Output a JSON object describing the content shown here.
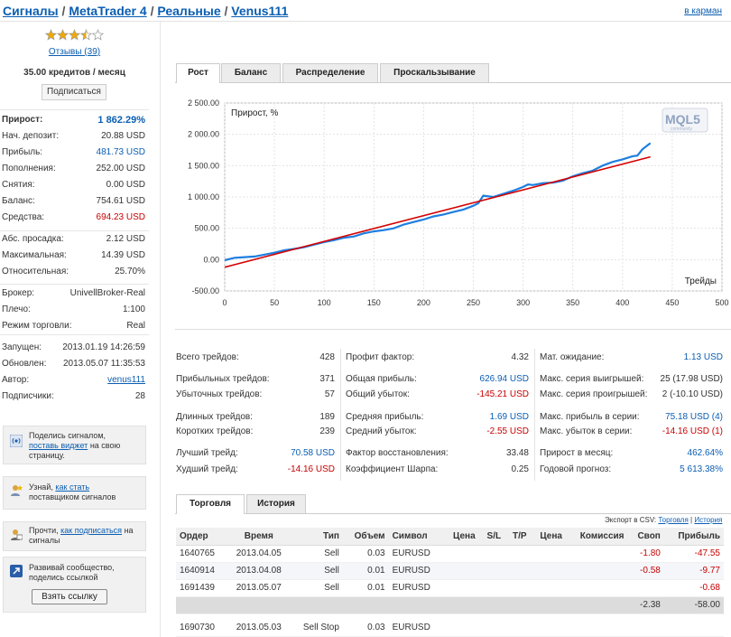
{
  "breadcrumb": {
    "items": [
      "Сигналы",
      "MetaTrader 4",
      "Реальные",
      "Venus111"
    ],
    "sep": "/"
  },
  "cart_link": "в карман",
  "sidebar": {
    "rating_stars": 3.5,
    "reviews": "Отзывы (39)",
    "price": "35.00 кредитов / месяц",
    "subscribe": "Подписаться",
    "growth": {
      "label": "Прирост:",
      "value": "1 862.29%"
    },
    "stats1": [
      {
        "label": "Нач. депозит:",
        "value": "20.88 USD"
      },
      {
        "label": "Прибыль:",
        "value": "481.73 USD"
      },
      {
        "label": "Пополнения:",
        "value": "252.00 USD"
      },
      {
        "label": "Снятия:",
        "value": "0.00 USD"
      },
      {
        "label": "Баланс:",
        "value": "754.61 USD"
      },
      {
        "label": "Средства:",
        "value": "694.23 USD"
      }
    ],
    "stats2": [
      {
        "label": "Абс. просадка:",
        "value": "2.12 USD"
      },
      {
        "label": "Максимальная:",
        "value": "14.39 USD"
      },
      {
        "label": "Относительная:",
        "value": "25.70%"
      }
    ],
    "stats3": [
      {
        "label": "Брокер:",
        "value": "UnivellBroker-Real"
      },
      {
        "label": "Плечо:",
        "value": "1:100"
      },
      {
        "label": "Режим торговли:",
        "value": "Real"
      }
    ],
    "stats4": [
      {
        "label": "Запущен:",
        "value": "2013.01.19 14:26:59"
      },
      {
        "label": "Обновлен:",
        "value": "2013.05.07 11:35:53"
      },
      {
        "label": "Автор:",
        "value": "venus111"
      },
      {
        "label": "Подписчики:",
        "value": "28"
      }
    ],
    "box1": {
      "pre": "Поделись сигналом,",
      "link": "поставь виджет",
      "post": "на свою страницу."
    },
    "box2": {
      "pre": "Узнай,",
      "link": "как стать",
      "post": "поставщиком сигналов"
    },
    "box3": {
      "pre": "Прочти,",
      "link": "как подписаться",
      "post": "на сигналы"
    },
    "box4": {
      "text": "Развивай сообщество, поделись ссылкой",
      "button": "Взять ссылку"
    }
  },
  "tabs": [
    "Рост",
    "Баланс",
    "Распределение",
    "Проскальзывание"
  ],
  "chart_data": {
    "type": "line",
    "ylabel": "Прирост, %",
    "xlabel": "Трейды",
    "watermark": "MQL5",
    "watermark_sub": "community",
    "xlim": [
      0,
      500
    ],
    "ylim": [
      -500,
      2500
    ],
    "x_ticks": [
      "0",
      "50",
      "100",
      "150",
      "200",
      "250",
      "300",
      "350",
      "400",
      "450",
      "500"
    ],
    "y_ticks": [
      "2 500.00",
      "2 000.00",
      "1 500.00",
      "1 000.00",
      "500.00",
      "0.00",
      "-500.00"
    ],
    "series": [
      {
        "color": "#1e7ee0",
        "x": [
          0,
          10,
          20,
          30,
          40,
          50,
          60,
          70,
          80,
          90,
          100,
          110,
          120,
          130,
          140,
          150,
          160,
          170,
          180,
          190,
          200,
          210,
          220,
          230,
          240,
          250,
          255,
          260,
          270,
          280,
          290,
          300,
          305,
          310,
          320,
          330,
          340,
          350,
          360,
          370,
          380,
          390,
          400,
          410,
          415,
          420,
          428
        ],
        "y": [
          -10,
          30,
          40,
          50,
          80,
          110,
          150,
          170,
          200,
          240,
          280,
          310,
          350,
          370,
          420,
          450,
          470,
          500,
          560,
          600,
          640,
          690,
          720,
          760,
          800,
          860,
          900,
          1020,
          1000,
          1050,
          1100,
          1160,
          1200,
          1190,
          1220,
          1230,
          1260,
          1330,
          1380,
          1420,
          1500,
          1560,
          1600,
          1650,
          1660,
          1760,
          1860
        ]
      },
      {
        "color": "#d40000",
        "x": [
          0,
          428
        ],
        "y": [
          -120,
          1640
        ]
      }
    ]
  },
  "stats_cols": [
    [
      {
        "label": "Всего трейдов:",
        "value": "428"
      },
      {
        "label": "Прибыльных трейдов:",
        "value": "371"
      },
      {
        "label": "Убыточных трейдов:",
        "value": "57"
      },
      {
        "label": "Длинных трейдов:",
        "value": "189"
      },
      {
        "label": "Коротких трейдов:",
        "value": "239"
      },
      {
        "label": "Лучший трейд:",
        "value": "70.58 USD"
      },
      {
        "label": "Худший трейд:",
        "value": "-14.16 USD"
      }
    ],
    [
      {
        "label": "Профит фактор:",
        "value": "4.32"
      },
      {
        "label": "Общая прибыль:",
        "value": "626.94 USD"
      },
      {
        "label": "Общий убыток:",
        "value": "-145.21 USD"
      },
      {
        "label": "Средняя прибыль:",
        "value": "1.69 USD"
      },
      {
        "label": "Средний убыток:",
        "value": "-2.55 USD"
      },
      {
        "label": "Фактор восстановления:",
        "value": "33.48"
      },
      {
        "label": "Коэффициент Шарпа:",
        "value": "0.25"
      }
    ],
    [
      {
        "label": "Мат. ожидание:",
        "value": "1.13 USD"
      },
      {
        "label": "Макс. серия выигрышей:",
        "value": "25 (17.98 USD)"
      },
      {
        "label": "Макс. серия проигрышей:",
        "value": "2 (-10.10 USD)"
      },
      {
        "label": "Макс. прибыль в серии:",
        "value": "75.18 USD (4)"
      },
      {
        "label": "Макс. убыток в серии:",
        "value": "-14.16 USD (1)"
      },
      {
        "label": "Прирост в месяц:",
        "value": "462.64%"
      },
      {
        "label": "Годовой прогноз:",
        "value": "5 613.38%"
      }
    ]
  ],
  "bottom_tabs": [
    "Торговля",
    "История"
  ],
  "csv": {
    "label": "Экспорт в CSV:",
    "trading": "Торговля",
    "sep": "|",
    "history": "История"
  },
  "table": {
    "headers": [
      "Ордер",
      "Время",
      "Тип",
      "Объем",
      "Символ",
      "Цена",
      "S/L",
      "T/P",
      "Цена",
      "Комиссия",
      "Своп",
      "Прибыль"
    ],
    "rows": [
      [
        "1640765",
        "2013.04.05",
        "Sell",
        "0.03",
        "EURUSD",
        "",
        "",
        "",
        "",
        "",
        "-1.80",
        "-47.55"
      ],
      [
        "1640914",
        "2013.04.08",
        "Sell",
        "0.01",
        "EURUSD",
        "",
        "",
        "",
        "",
        "",
        "-0.58",
        "-9.77"
      ],
      [
        "1691439",
        "2013.05.07",
        "Sell",
        "0.01",
        "EURUSD",
        "",
        "",
        "",
        "",
        "",
        "",
        "-0.68"
      ]
    ],
    "total": {
      "swap": "-2.38",
      "profit": "-58.00"
    },
    "pending": [
      "1690730",
      "2013.05.03",
      "Sell Stop",
      "0.03",
      "EURUSD"
    ]
  },
  "colors": {
    "link": "#0b5eb2",
    "negative": "#c80000",
    "growth_line": "#1e7ee0",
    "trend_line": "#d40000"
  }
}
